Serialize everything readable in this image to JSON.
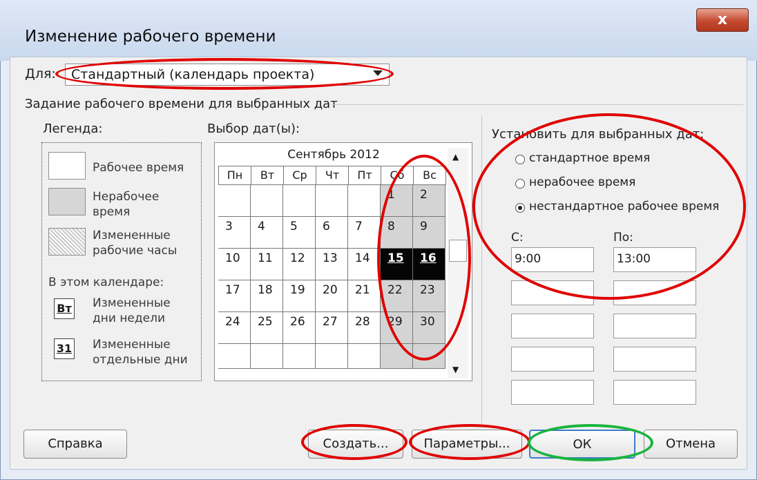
{
  "window": {
    "title": "Изменение рабочего времени",
    "close_glyph": "x"
  },
  "for_row": {
    "label": "Для:",
    "calendar_value": "Стандартный (календарь проекта)"
  },
  "group_title": "Задание рабочего времени для выбранных дат",
  "legend": {
    "title": "Легенда:",
    "items": [
      {
        "label_line1": "Рабочее время",
        "label_line2": ""
      },
      {
        "label_line1": "Нерабочее",
        "label_line2": "время"
      },
      {
        "label_line1": "Измененные",
        "label_line2": "рабочие часы"
      }
    ],
    "in_calendar_title": "В этом календаре:",
    "changed_weekdays": {
      "badge": "Вт",
      "line1": "Измененные",
      "line2": "дни недели"
    },
    "changed_days": {
      "badge": "31",
      "line1": "Измененные",
      "line2": "отдельные дни"
    }
  },
  "date_picker": {
    "label": "Выбор дат(ы):",
    "month": "Сентябрь 2012",
    "weekdays": [
      "Пн",
      "Вт",
      "Ср",
      "Чт",
      "Пт",
      "Сб",
      "Вс"
    ],
    "weeks": [
      [
        "",
        "",
        "",
        "",
        "",
        "1",
        "2"
      ],
      [
        "3",
        "4",
        "5",
        "6",
        "7",
        "8",
        "9"
      ],
      [
        "10",
        "11",
        "12",
        "13",
        "14",
        "15",
        "16"
      ],
      [
        "17",
        "18",
        "19",
        "20",
        "21",
        "22",
        "23"
      ],
      [
        "24",
        "25",
        "26",
        "27",
        "28",
        "29",
        "30"
      ],
      [
        "",
        "",
        "",
        "",
        "",
        "",
        ""
      ]
    ],
    "selected": [
      "15",
      "16"
    ]
  },
  "settings": {
    "title": "Установить для выбранных дат:",
    "options": [
      {
        "label": "стандартное время",
        "checked": false
      },
      {
        "label": "нерабочее время",
        "checked": false
      },
      {
        "label": "нестандартное рабочее время",
        "checked": true
      }
    ],
    "from_label": "С:",
    "to_label": "По:",
    "from_values": [
      "9:00",
      "",
      "",
      "",
      ""
    ],
    "to_values": [
      "13:00",
      "",
      "",
      "",
      ""
    ]
  },
  "buttons": {
    "help": "Справка",
    "create": "Создать...",
    "params": "Параметры...",
    "ok": "ОК",
    "cancel": "Отмена"
  },
  "colors": {
    "highlight_red": "#e00000",
    "highlight_green": "#19b43c",
    "selected_day": "#050505",
    "weekend": "#d4d4d4"
  }
}
